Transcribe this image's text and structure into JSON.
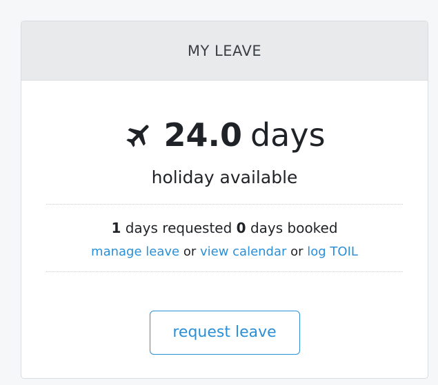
{
  "card": {
    "title": "MY LEAVE",
    "headline": {
      "icon": "plane-icon",
      "value": "24.0",
      "unit": "days"
    },
    "subtitle": "holiday available",
    "counts": {
      "requested_value": "1",
      "requested_label": " days requested ",
      "booked_value": "0",
      "booked_label": " days booked"
    },
    "links": {
      "manage_leave": "manage leave",
      "separator_1": " or ",
      "view_calendar": "view calendar",
      "separator_2": " or ",
      "log_toil": "log TOIL"
    },
    "button_label": "request leave"
  },
  "colors": {
    "link": "#2a8fd6",
    "header_bg": "#e8eaec",
    "text": "#1f2226"
  }
}
